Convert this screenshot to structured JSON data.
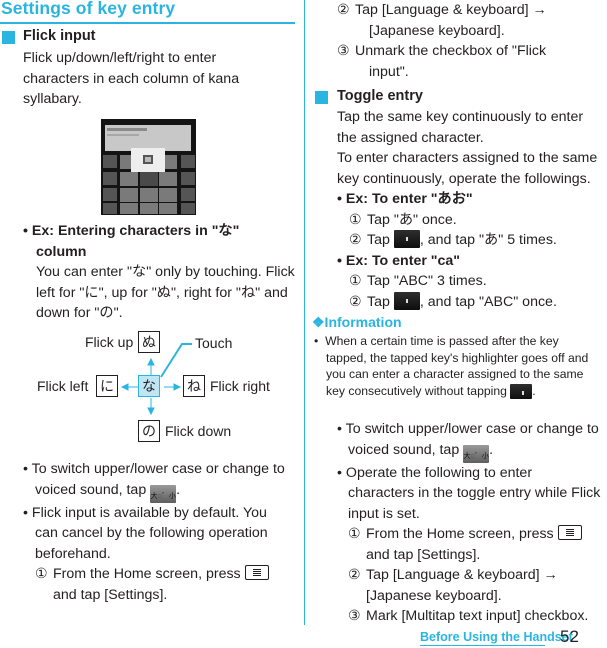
{
  "page": {
    "title": "Settings of key entry",
    "footer_section": "Before Using the Handset",
    "page_number": "52"
  },
  "left": {
    "flick": {
      "heading": "Flick input",
      "desc_lines": [
        "Flick up/down/left/right to enter",
        "characters in each column of kana",
        "syllabary."
      ],
      "example_heading_lines": [
        "Ex: Entering characters in \"な\"",
        "column"
      ],
      "example_lines": [
        "You can enter \"な\" only by touching. Flick",
        "left for \"に\", up for \"ぬ\", right for \"ね\" and",
        "down for \"の\"."
      ],
      "diagram": {
        "center": "な",
        "up": "ぬ",
        "left": "に",
        "right": "ね",
        "down": "の",
        "label_up": "Flick up",
        "label_left": "Flick left",
        "label_right": "Flick right",
        "label_down": "Flick down",
        "label_touch": "Touch"
      },
      "note1_lines": [
        "To switch upper/lower case or change to",
        "voiced sound, tap"
      ],
      "note2_lines": [
        "Flick input is available by default. You",
        "can cancel by the following operation",
        "beforehand."
      ],
      "steps": [
        {
          "num": "①",
          "lines": [
            "From the Home screen, press",
            "and tap [Settings]."
          ]
        }
      ]
    }
  },
  "right": {
    "flick_steps": [
      {
        "num": "②",
        "lines": [
          "Tap [Language & keyboard] →",
          "[Japanese keyboard]."
        ]
      },
      {
        "num": "③",
        "lines": [
          "Unmark the checkbox of \"Flick",
          "input\"."
        ]
      }
    ],
    "toggle": {
      "heading": "Toggle entry",
      "desc_lines": [
        "Tap the same key continuously to enter",
        "the assigned character.",
        "To enter characters assigned to the same",
        "key continuously, operate the followings."
      ],
      "ex1_heading": "Ex: To enter \"あお\"",
      "ex1_steps": [
        {
          "num": "①",
          "text": "Tap \"あ\" once."
        },
        {
          "num": "②",
          "pre": "Tap",
          "post": ", and tap \"あ\" 5 times."
        }
      ],
      "ex2_heading": "Ex: To enter \"ca\"",
      "ex2_steps": [
        {
          "num": "①",
          "text": "Tap \"ABC\" 3 times."
        },
        {
          "num": "②",
          "pre": "Tap",
          "post": ", and tap \"ABC\" once."
        }
      ]
    },
    "information": {
      "heading": "❖Information",
      "lines": [
        "When a certain time is passed after the key",
        "tapped, the tapped key's highlighter goes off and",
        "you can enter a character assigned to the same",
        "key consecutively without tapping"
      ],
      "note1_lines": [
        "To switch upper/lower case or change to",
        "voiced sound, tap"
      ],
      "note2_lines": [
        "Operate the following to enter",
        "characters in the toggle entry while Flick",
        "input is set."
      ],
      "steps": [
        {
          "num": "①",
          "lines": [
            "From the Home screen, press",
            "and tap [Settings]."
          ]
        },
        {
          "num": "②",
          "lines": [
            "Tap [Language & keyboard] →",
            "[Japanese keyboard]."
          ]
        },
        {
          "num": "③",
          "lines": [
            "Mark [Multitap text input] checkbox."
          ]
        }
      ]
    }
  },
  "icons": {
    "case_key_label": "大◌゛小",
    "bullet": "•"
  },
  "colors": {
    "accent": "#29b5e0",
    "text": "#231f20"
  }
}
